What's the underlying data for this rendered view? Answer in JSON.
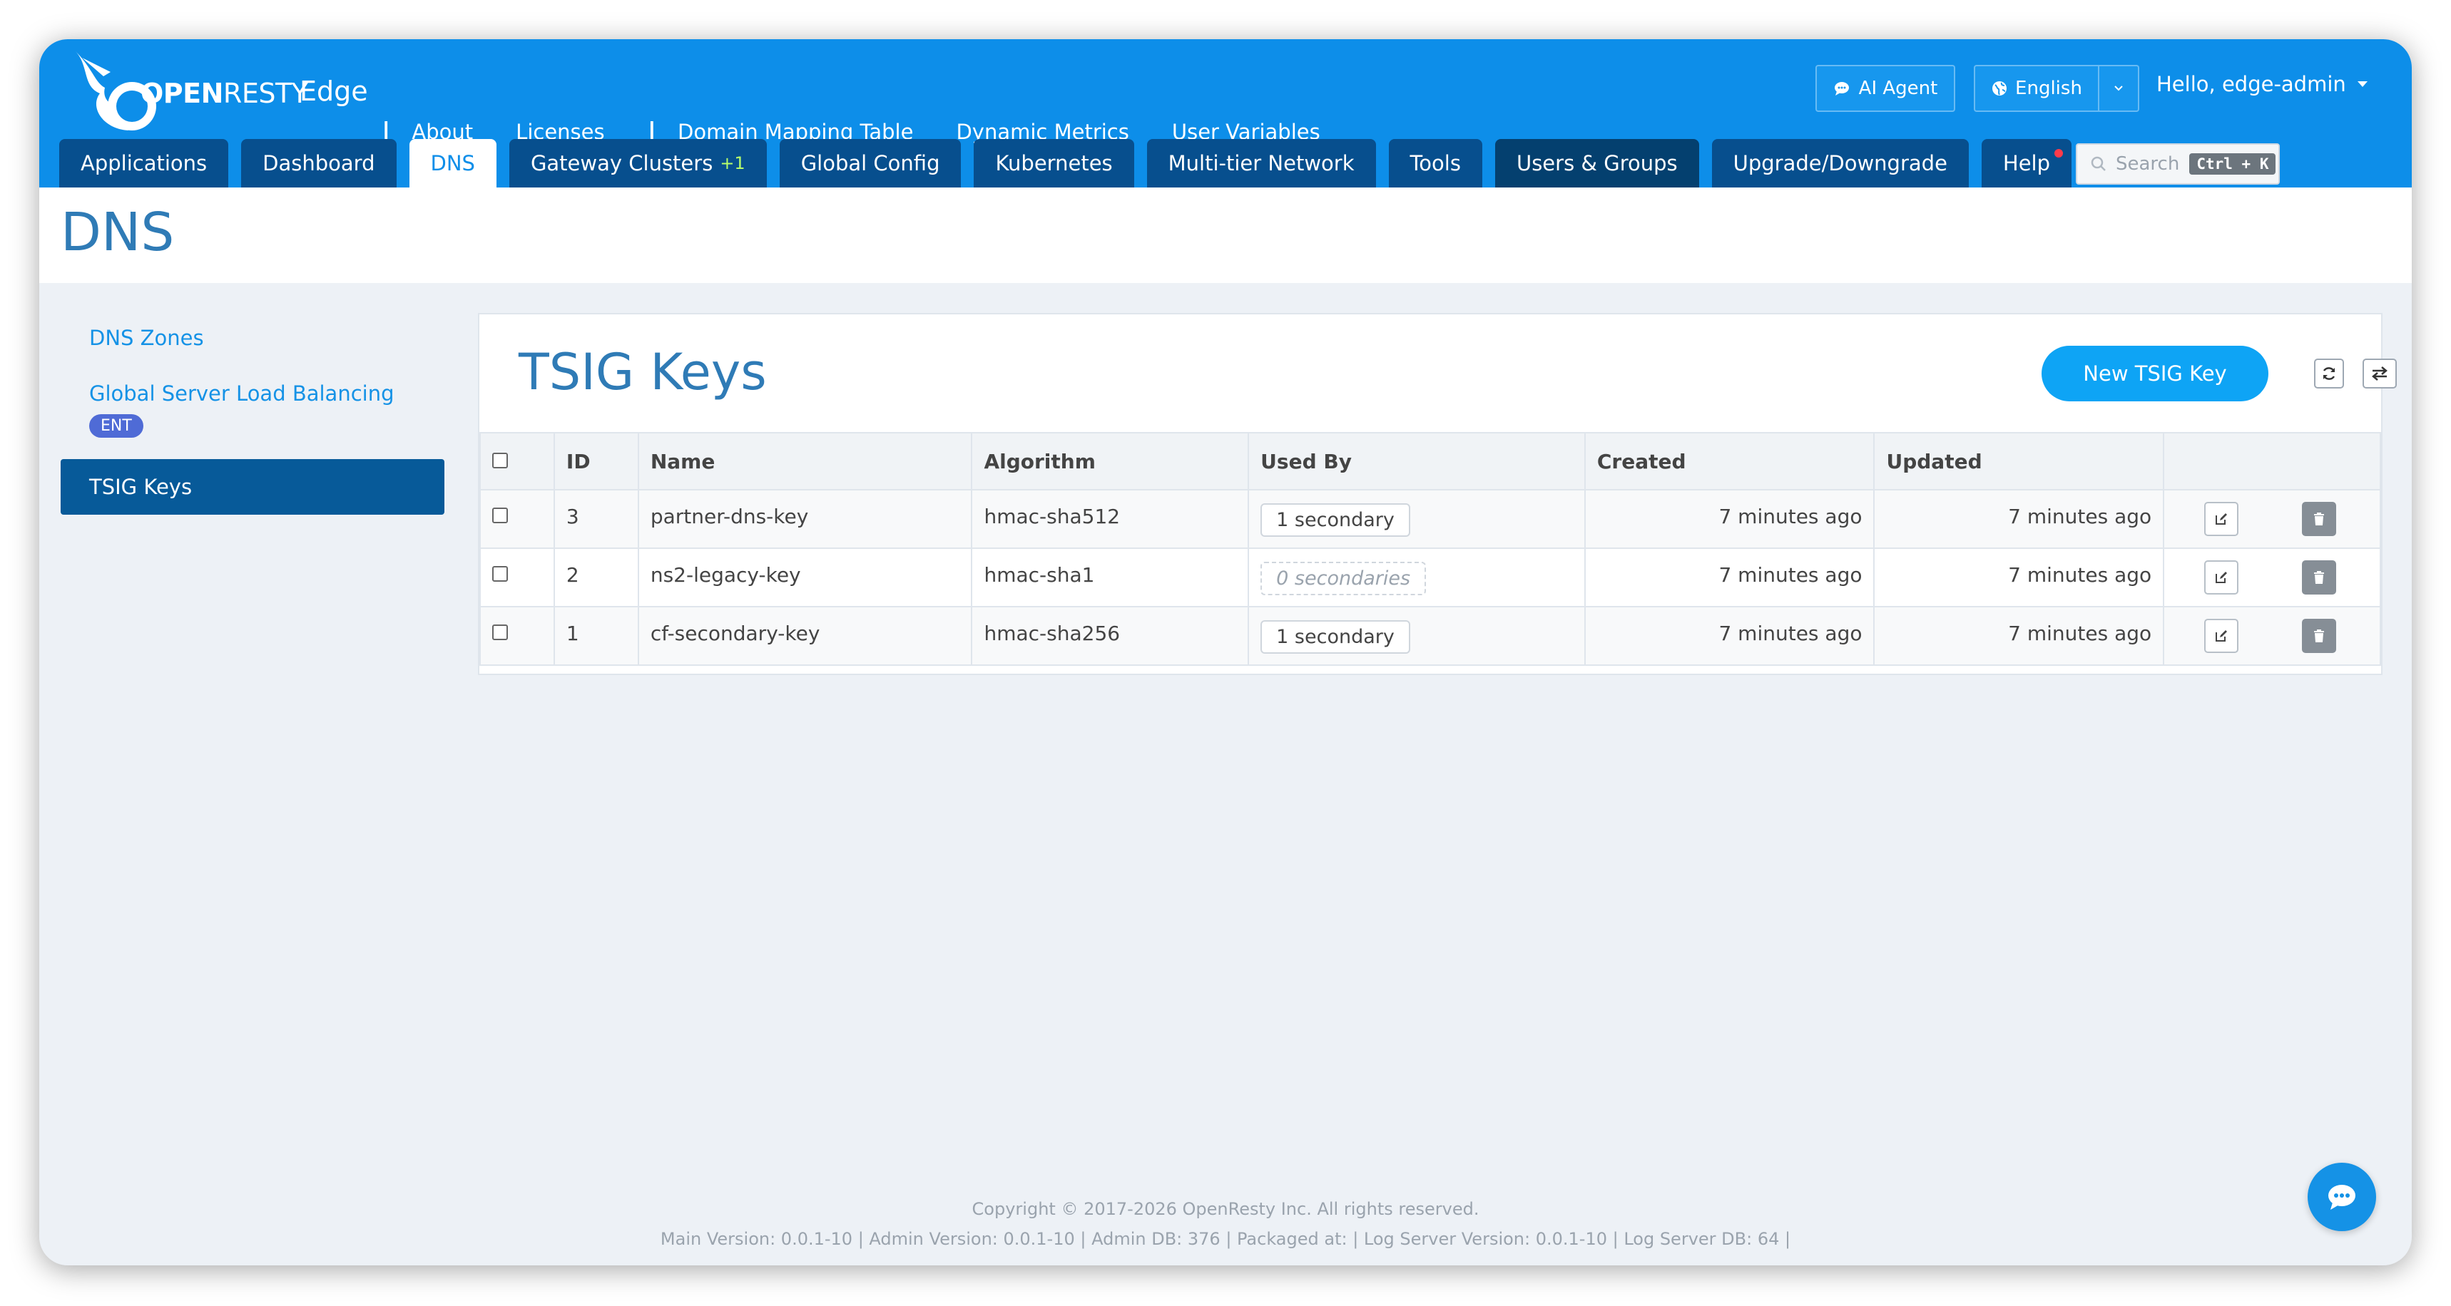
{
  "brand": {
    "logo_bold": "OPEN",
    "logo_rest": "RESTY",
    "product": "Edge"
  },
  "topnav": {
    "about": "About",
    "licenses": "Licenses",
    "domain_mapping": "Domain Mapping Table",
    "dynamic_metrics": "Dynamic Metrics",
    "user_variables": "User Variables"
  },
  "header": {
    "ai_agent": "AI Agent",
    "language": "English",
    "greeting": "Hello, edge-admin",
    "search_placeholder": "Search",
    "search_shortcut": "Ctrl + K"
  },
  "tabs": {
    "applications": "Applications",
    "dashboard": "Dashboard",
    "dns": "DNS",
    "gateway_clusters": "Gateway Clusters",
    "gateway_badge": "+1",
    "global_config": "Global Config",
    "kubernetes": "Kubernetes",
    "multitier": "Multi-tier Network",
    "tools": "Tools",
    "users_groups": "Users & Groups",
    "upgrade": "Upgrade/Downgrade",
    "help": "Help"
  },
  "page": {
    "title": "DNS"
  },
  "sidebar": {
    "dns_zones": "DNS Zones",
    "gslb": "Global Server Load Balancing",
    "gslb_badge": "ENT",
    "tsig_keys": "TSIG Keys"
  },
  "panel": {
    "title": "TSIG Keys",
    "new_button": "New TSIG Key",
    "columns": {
      "id": "ID",
      "name": "Name",
      "algorithm": "Algorithm",
      "used_by": "Used By",
      "created": "Created",
      "updated": "Updated"
    },
    "rows": [
      {
        "id": "3",
        "name": "partner-dns-key",
        "algorithm": "hmac-sha512",
        "used_by": "1 secondary",
        "created": "7 minutes ago",
        "updated": "7 minutes ago"
      },
      {
        "id": "2",
        "name": "ns2-legacy-key",
        "algorithm": "hmac-sha1",
        "used_by": "0 secondaries",
        "created": "7 minutes ago",
        "updated": "7 minutes ago"
      },
      {
        "id": "1",
        "name": "cf-secondary-key",
        "algorithm": "hmac-sha256",
        "used_by": "1 secondary",
        "created": "7 minutes ago",
        "updated": "7 minutes ago"
      }
    ]
  },
  "footer": {
    "copyright": "Copyright © 2017-2026 OpenResty Inc. All rights reserved.",
    "versions": "Main Version: 0.0.1-10 | Admin Version: 0.0.1-10 | Admin DB: 376 | Packaged at:  | Log Server Version: 0.0.1-10 | Log Server DB: 64 |"
  },
  "colors": {
    "header": "#0d8ee9",
    "tab": "#074f8e",
    "accent": "#0ea4f5",
    "title": "#2f7bb6"
  }
}
